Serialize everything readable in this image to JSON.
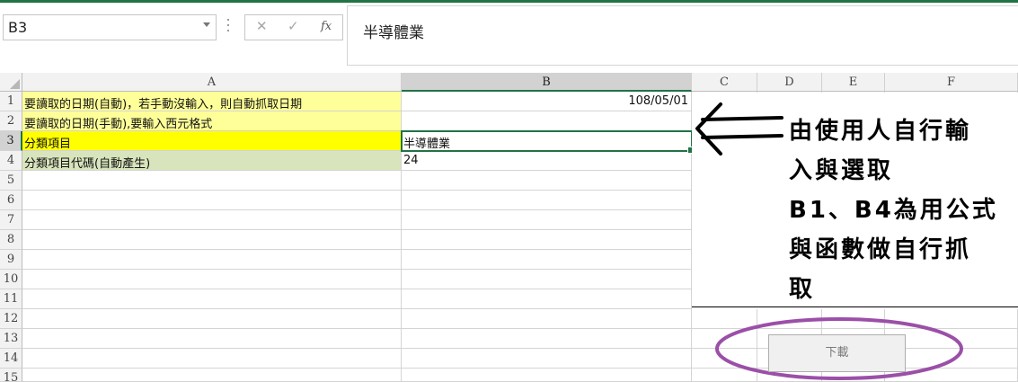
{
  "app": {
    "accent": "#217346"
  },
  "formula_bar": {
    "name_box": "B3",
    "cancel_icon": "✕",
    "enter_icon": "✓",
    "fx_label": "fx",
    "content": "半導體業"
  },
  "columns": [
    "A",
    "B",
    "C",
    "D",
    "E",
    "F"
  ],
  "rows": [
    "1",
    "2",
    "3",
    "4",
    "5",
    "6",
    "7",
    "8",
    "9",
    "10",
    "11",
    "12",
    "13",
    "14",
    "15"
  ],
  "cells": {
    "A1": "要讀取的日期(自動)，若手動沒輸入，則自動抓取日期",
    "B1": "108/05/01",
    "A2": "要讀取的日期(手動),要輸入西元格式",
    "B2": "",
    "A3": "分類項目",
    "B3": "半導體業",
    "A4": "分類項目代碼(自動產生)",
    "B4": "24"
  },
  "note": {
    "lines": [
      "由使用人自行輸",
      "入與選取",
      "B1、B4為用公式",
      "與函數做自行抓",
      "取"
    ]
  },
  "download_button": {
    "label": "下載"
  },
  "colors": {
    "light_yellow": "#ffff99",
    "yellow": "#ffff00",
    "light_green": "#d8e4bc",
    "ellipse": "#9b4fa8"
  }
}
